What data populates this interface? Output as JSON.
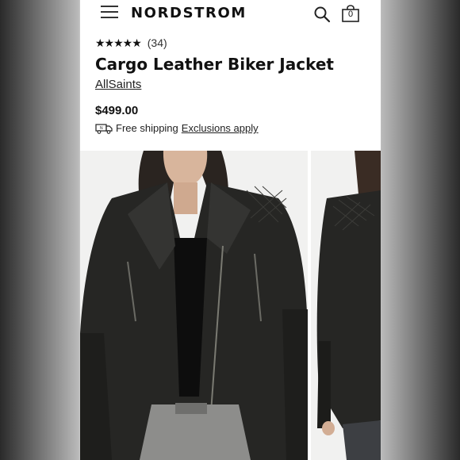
{
  "header": {
    "brand": "NORDSTROM",
    "bag_count": "0"
  },
  "product": {
    "stars": "★★★★★",
    "review_count": "(34)",
    "title": "Cargo Leather Biker Jacket",
    "brand": "AllSaints",
    "price": "$499.00",
    "shipping_text": "Free shipping",
    "exclusions_link": "Exclusions apply"
  },
  "icons": {
    "menu": "hamburger-icon",
    "search": "search-icon",
    "bag": "shopping-bag-icon",
    "shipping": "truck-icon"
  },
  "colors": {
    "text": "#111111",
    "background": "#ffffff"
  }
}
